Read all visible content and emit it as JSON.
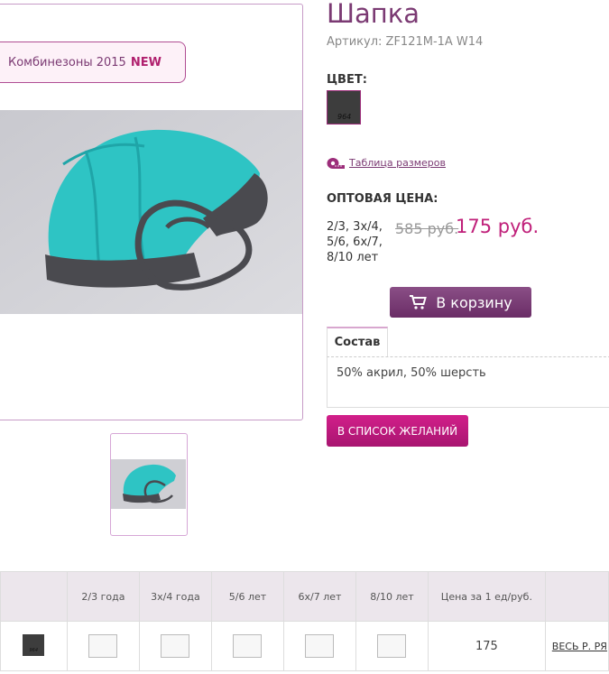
{
  "product": {
    "title": "Шапка",
    "sku": "Артикул: ZF121M-1A W14",
    "color_label": "ЦВЕТ:",
    "color_code": "964",
    "color_hex": "#3d3d3d",
    "size_chart_link": "Таблица размеров",
    "wholesale_label": "ОПТОВАЯ ЦЕНА:",
    "sizes_text": "2/3, 3х/4, 5/6, 6х/7, 8/10 лет",
    "old_price": "585 руб.",
    "new_price": "175 руб.",
    "cart_button": "В корзину",
    "wishlist_button": "В СПИСОК ЖЕЛАНИЙ"
  },
  "collection": {
    "label": "Комбинезоны 2015",
    "badge": "NEW"
  },
  "tabs": [
    {
      "label": "Состав",
      "content": "50% акрил, 50% шерсть"
    }
  ],
  "table": {
    "headers": [
      "",
      "2/3 года",
      "3х/4 года",
      "5/6 лет",
      "6х/7 лет",
      "8/10 лет",
      "Цена за 1 ед/руб.",
      ""
    ],
    "row": {
      "color_code": "964",
      "price": "175",
      "all_link": "ВЕСЬ Р. РЯ"
    }
  },
  "colors": {
    "accent": "#7b3a73",
    "price": "#c0207a",
    "wishlist": "#d21f8a",
    "hat_main": "#2ec4c4",
    "hat_trim": "#4a4a4f"
  }
}
